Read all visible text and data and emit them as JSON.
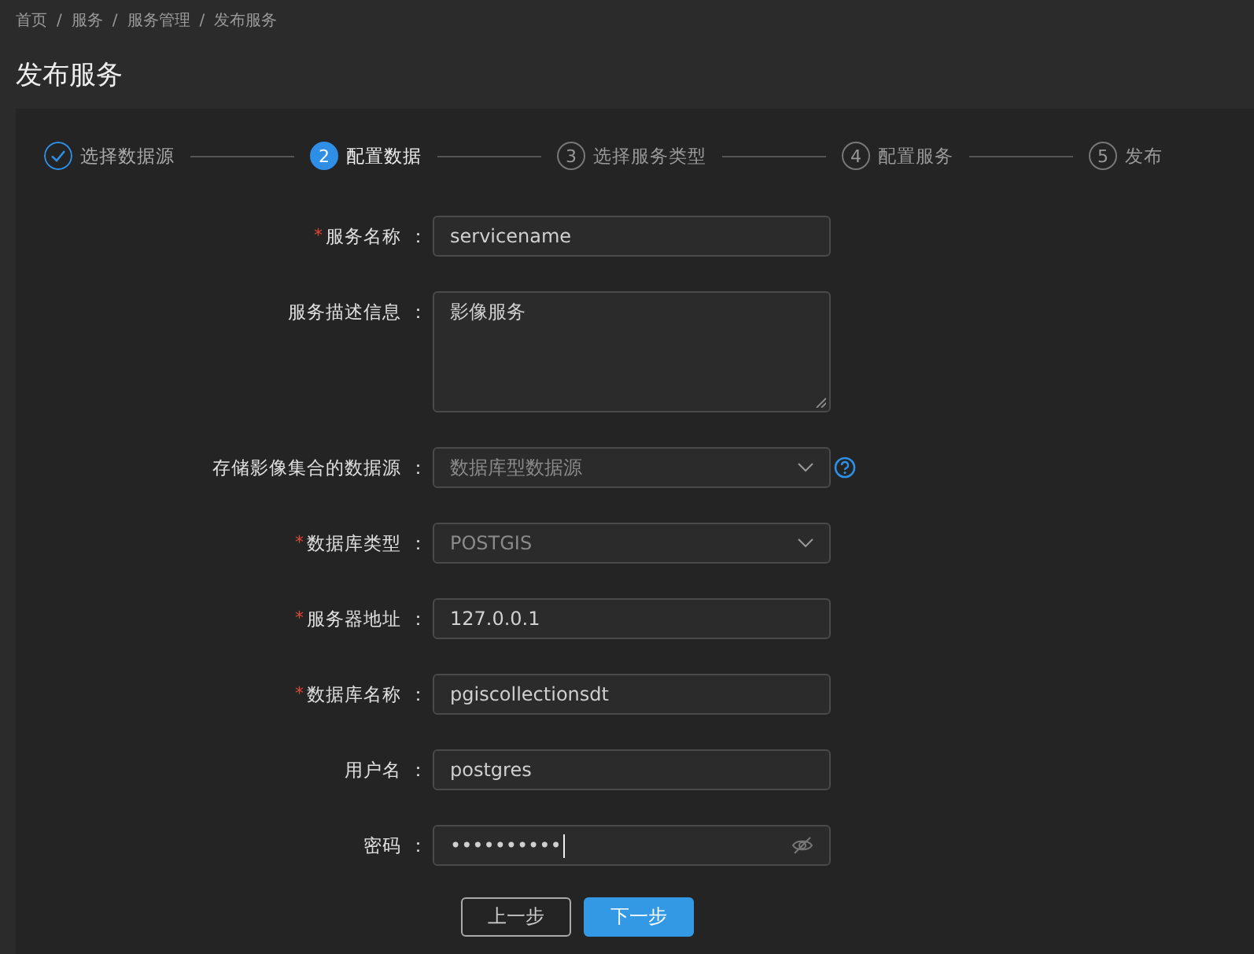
{
  "breadcrumb": {
    "items": [
      "首页",
      "服务",
      "服务管理",
      "发布服务"
    ],
    "separator": "/"
  },
  "required_mark": "*",
  "title": "发布服务",
  "steps": [
    {
      "label": "选择数据源",
      "done": true,
      "active": false
    },
    {
      "number": "2",
      "label": "配置数据",
      "done": false,
      "active": true
    },
    {
      "number": "3",
      "label": "选择服务类型",
      "done": false,
      "active": false
    },
    {
      "number": "4",
      "label": "配置服务",
      "done": false,
      "active": false
    },
    {
      "number": "5",
      "label": "发布",
      "done": false,
      "active": false
    }
  ],
  "fields": [
    {
      "label": "服务名称",
      "required": true,
      "kind": "input",
      "value": "servicename"
    },
    {
      "label": "服务描述信息",
      "required": false,
      "kind": "textarea",
      "value": "影像服务"
    },
    {
      "label": "存储影像集合的数据源",
      "required": false,
      "kind": "select",
      "value": "数据库型数据源",
      "disabled": true,
      "help": true
    },
    {
      "label": "数据库类型",
      "required": true,
      "kind": "select",
      "value": "POSTGIS",
      "disabled": true
    },
    {
      "label": "服务器地址",
      "required": true,
      "kind": "input",
      "value": "127.0.0.1"
    },
    {
      "label": "数据库名称",
      "required": true,
      "kind": "input",
      "value": "pgiscollectionsdt"
    },
    {
      "label": "用户名",
      "required": false,
      "kind": "input",
      "value": "postgres"
    },
    {
      "label": "密码",
      "required": false,
      "kind": "password",
      "value": "••••••••••"
    }
  ],
  "separator": "：",
  "buttons": [
    {
      "label": "上一步",
      "kind": "secondary"
    },
    {
      "label": "下一步",
      "kind": "primary"
    }
  ]
}
